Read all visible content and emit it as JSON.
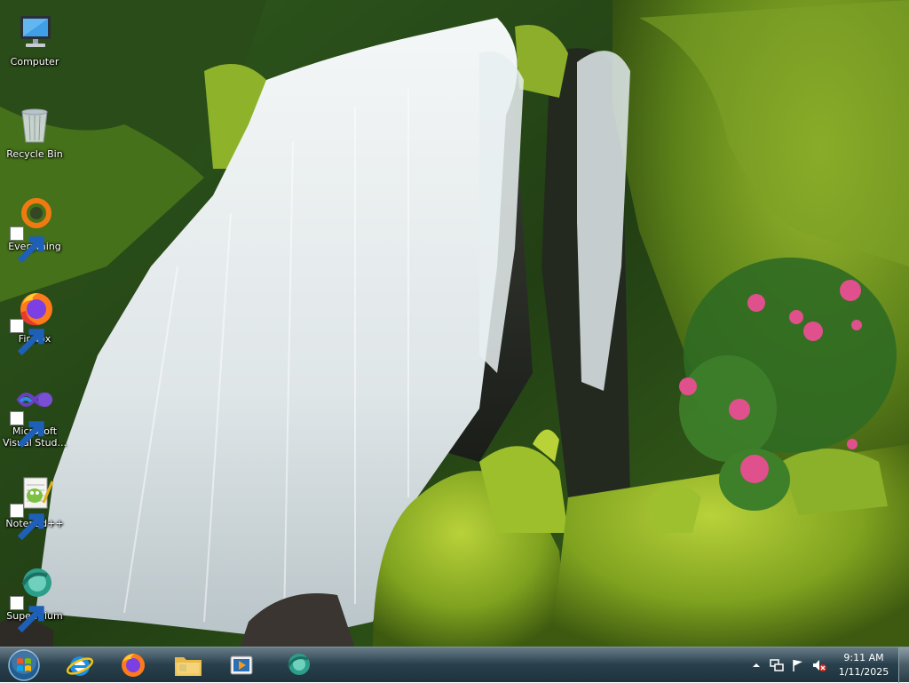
{
  "desktop": {
    "wallpaper": "waterfall-wallpaper",
    "icons": [
      {
        "label": "Computer",
        "icon": "computer-icon"
      },
      {
        "label": "Recycle Bin",
        "icon": "recycle-bin-icon"
      },
      {
        "label": "Everything",
        "icon": "everything-icon"
      },
      {
        "label": "Firefox",
        "icon": "firefox-icon"
      },
      {
        "label": "Microsoft Visual Stud...",
        "icon": "visual-studio-icon"
      },
      {
        "label": "Notepad++",
        "icon": "notepad-plus-plus-icon"
      },
      {
        "label": "Supermium",
        "icon": "supermium-icon"
      }
    ]
  },
  "taskbar": {
    "start": "start-orb-icon",
    "pinned": [
      {
        "icon": "internet-explorer-icon"
      },
      {
        "icon": "firefox-icon"
      },
      {
        "icon": "file-explorer-icon"
      },
      {
        "icon": "media-player-icon"
      },
      {
        "icon": "supermium-icon"
      }
    ],
    "tray": {
      "icons": [
        "show-hidden-icons-icon",
        "network-icon",
        "action-center-flag-icon",
        "volume-muted-icon"
      ],
      "time": "9:11 AM",
      "date": "1/11/2025"
    }
  }
}
